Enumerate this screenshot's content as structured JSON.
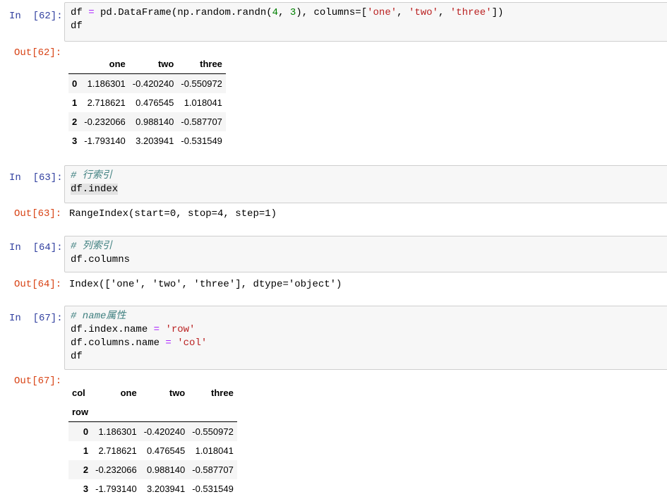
{
  "cells": [
    {
      "in_prompt": "In  [62]:",
      "out_prompt": "Out[62]:",
      "code": {
        "l1_a": "df ",
        "l1_eq": "=",
        "l1_b": " pd.DataFrame(np.random.randn(",
        "l1_n1": "4",
        "l1_c": ", ",
        "l1_n2": "3",
        "l1_d": "), columns=[",
        "l1_s1": "'one'",
        "l1_e": ", ",
        "l1_s2": "'two'",
        "l1_f": ", ",
        "l1_s3": "'three'",
        "l1_g": "])",
        "l2": "df"
      },
      "table": {
        "columns": [
          "",
          "one",
          "two",
          "three"
        ],
        "rows": [
          [
            "0",
            "1.186301",
            "-0.420240",
            "-0.550972"
          ],
          [
            "1",
            "2.718621",
            "0.476545",
            "1.018041"
          ],
          [
            "2",
            "-0.232066",
            "0.988140",
            "-0.587707"
          ],
          [
            "3",
            "-1.793140",
            "3.203941",
            "-0.531549"
          ]
        ]
      }
    },
    {
      "in_prompt": "In  [63]:",
      "out_prompt": "Out[63]:",
      "code": {
        "comment": "# 行索引",
        "l2": "df.index"
      },
      "output": "RangeIndex(start=0, stop=4, step=1)"
    },
    {
      "in_prompt": "In  [64]:",
      "out_prompt": "Out[64]:",
      "code": {
        "comment": "# 列索引",
        "l2": "df.columns"
      },
      "output": "Index(['one', 'two', 'three'], dtype='object')"
    },
    {
      "in_prompt": "In  [67]:",
      "out_prompt": "Out[67]:",
      "code": {
        "comment": "# name属性",
        "l2_a": "df.index.name ",
        "l2_eq": "=",
        "l2_sp": " ",
        "l2_s": "'row'",
        "l3_a": "df.columns.name ",
        "l3_eq": "=",
        "l3_sp": " ",
        "l3_s": "'col'",
        "l4": "df"
      },
      "table": {
        "columns_name": "col",
        "columns": [
          "one",
          "two",
          "three"
        ],
        "index_name": "row",
        "rows": [
          [
            "0",
            "1.186301",
            "-0.420240",
            "-0.550972"
          ],
          [
            "1",
            "2.718621",
            "0.476545",
            "1.018041"
          ],
          [
            "2",
            "-0.232066",
            "0.988140",
            "-0.587707"
          ],
          [
            "3",
            "-1.793140",
            "3.203941",
            "-0.531549"
          ]
        ]
      }
    }
  ]
}
